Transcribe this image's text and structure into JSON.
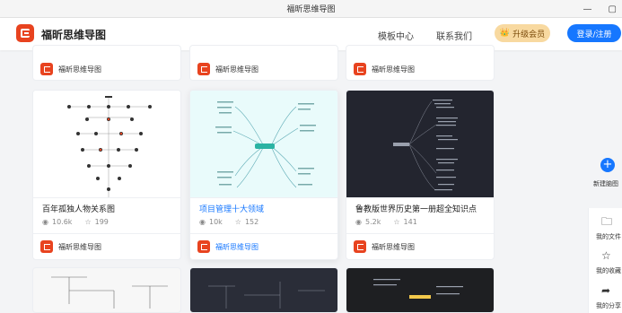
{
  "window": {
    "title": "福昕思维导图",
    "minimize": "—",
    "maximize": "▢"
  },
  "header": {
    "brand": "福昕思维导图",
    "nav_templates": "模板中心",
    "nav_contact": "联系我们",
    "vip_label": "升级会员",
    "login_label": "登录/注册"
  },
  "top_row": [
    {
      "author": "福昕思维导图"
    },
    {
      "author": "福昕思维导图"
    },
    {
      "author": "福昕思维导图"
    }
  ],
  "cards": [
    {
      "title": "百年孤独人物关系图",
      "views": "10.6k",
      "stars": "199",
      "author": "福昕思维导图"
    },
    {
      "title": "项目管理十大领域",
      "views": "10k",
      "stars": "152",
      "author": "福昕思维导图"
    },
    {
      "title": "鲁教版世界历史第一册超全知识点",
      "views": "5.2k",
      "stars": "141",
      "author": "福昕思维导图"
    }
  ],
  "right_panel": {
    "new_label": "新建脑图",
    "files_label": "我的文件",
    "favorites_label": "我的收藏",
    "shared_label": "我的分享"
  },
  "colors": {
    "accent": "#1677ff",
    "brand": "#e8431f",
    "vip_bg": "#f8d9a0",
    "dark_thumb": "#23252f"
  }
}
